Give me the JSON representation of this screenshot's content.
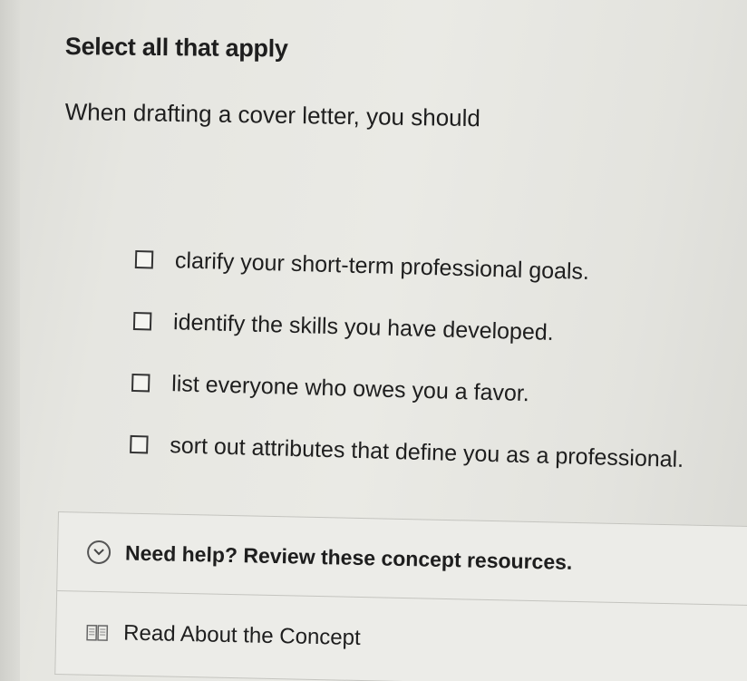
{
  "prompt": {
    "instruction": "Select all that apply",
    "question": "When drafting a cover letter, you should"
  },
  "options": [
    {
      "label": "clarify your short-term professional goals.",
      "checked": false
    },
    {
      "label": "identify the skills you have developed.",
      "checked": false
    },
    {
      "label": "list everyone who owes you a favor.",
      "checked": false
    },
    {
      "label": "sort out attributes that define you as a professional.",
      "checked": false
    }
  ],
  "help": {
    "toggle_label": "Need help? Review these concept resources.",
    "toggle_icon": "chevron-down-circle-icon",
    "resources": [
      {
        "label": "Read About the Concept",
        "icon": "book-icon"
      }
    ]
  }
}
